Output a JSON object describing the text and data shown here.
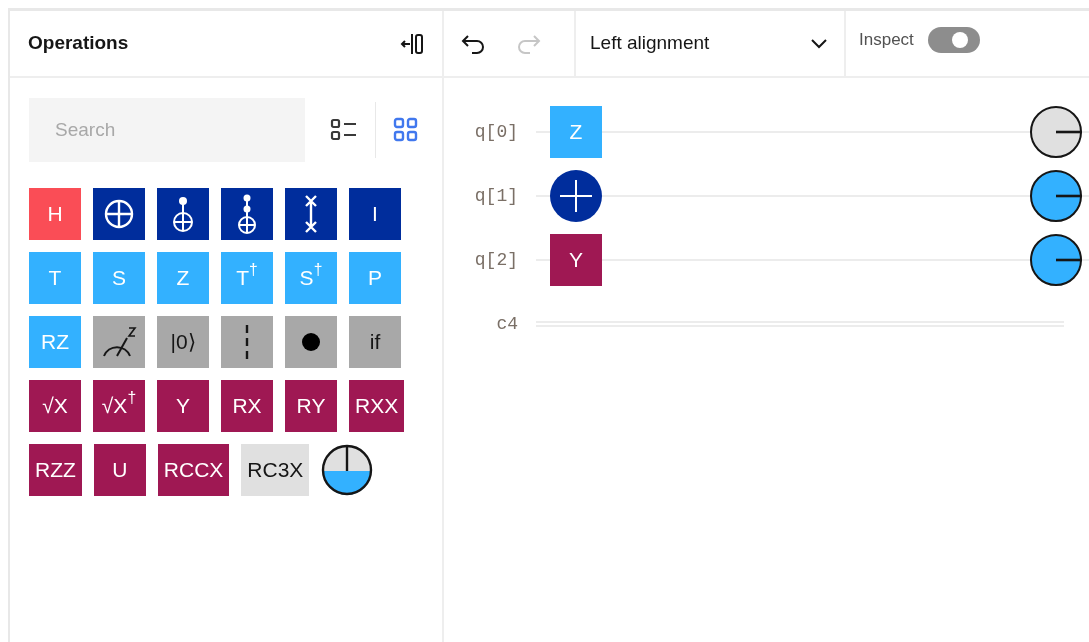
{
  "panel": {
    "title": "Operations"
  },
  "search": {
    "placeholder": "Search"
  },
  "view_buttons": [
    {
      "kind": "list",
      "selected": false
    },
    {
      "kind": "grid",
      "selected": true
    }
  ],
  "gates": [
    {
      "kind": "text",
      "label": "H",
      "color": "#fa4d56"
    },
    {
      "kind": "cnot",
      "color": "#002d9c"
    },
    {
      "kind": "toffoli",
      "color": "#002d9c"
    },
    {
      "kind": "c3x",
      "color": "#002d9c"
    },
    {
      "kind": "swap",
      "color": "#002d9c"
    },
    {
      "kind": "text",
      "label": "I",
      "color": "#002d9c"
    },
    {
      "kind": "text",
      "label": "T",
      "color": "#33b1ff"
    },
    {
      "kind": "text",
      "label": "S",
      "color": "#33b1ff"
    },
    {
      "kind": "text",
      "label": "Z",
      "color": "#33b1ff"
    },
    {
      "kind": "text",
      "label": "T$^{†}$",
      "color": "#33b1ff"
    },
    {
      "kind": "text",
      "label": "S$^{†}$",
      "color": "#33b1ff"
    },
    {
      "kind": "text",
      "label": "P",
      "color": "#33b1ff"
    },
    {
      "kind": "text",
      "label": "RZ",
      "color": "#33b1ff"
    },
    {
      "kind": "measure",
      "color": "#a8a8a8"
    },
    {
      "kind": "text",
      "label": "|0⟩",
      "color": "#a8a8a8"
    },
    {
      "kind": "barrier",
      "color": "#a8a8a8"
    },
    {
      "kind": "control",
      "color": "#a8a8a8"
    },
    {
      "kind": "text",
      "label": "if",
      "color": "#a8a8a8"
    },
    {
      "kind": "text",
      "label": "√X",
      "color": "#9f1853"
    },
    {
      "kind": "text",
      "label": "√X$^{†}$",
      "color": "#9f1853"
    },
    {
      "kind": "text",
      "label": "Y",
      "color": "#9f1853"
    },
    {
      "kind": "text",
      "label": "RX",
      "color": "#9f1853"
    },
    {
      "kind": "text",
      "label": "RY",
      "color": "#9f1853"
    },
    {
      "kind": "text",
      "label": "RXX",
      "color": "#9f1853"
    },
    {
      "kind": "text",
      "label": "RZZ",
      "color": "#9f1853"
    },
    {
      "kind": "text",
      "label": "U",
      "color": "#9f1853"
    },
    {
      "kind": "text",
      "label": "RCCX",
      "color": "#9f1853"
    },
    {
      "kind": "text",
      "label": "RC3X",
      "color": "#e0e0e0"
    },
    {
      "kind": "probability"
    }
  ],
  "toolbar": {
    "undo": {
      "disabled": false
    },
    "redo": {
      "disabled": true
    },
    "alignment": "Left alignment",
    "inspect": {
      "label": "Inspect",
      "disabled": true
    }
  },
  "circuit": {
    "qubits": [
      {
        "label": "q[0]",
        "gate": {
          "kind": "box",
          "label": "Z",
          "color": "#33b1ff"
        },
        "measure": {
          "color": "#e0e0e0"
        }
      },
      {
        "label": "q[1]",
        "gate": {
          "kind": "target",
          "color": "#002d9c"
        },
        "measure": {
          "color": "#33b1ff"
        }
      },
      {
        "label": "q[2]",
        "gate": {
          "kind": "box",
          "label": "Y",
          "color": "#9f1853"
        },
        "measure": {
          "color": "#33b1ff"
        }
      }
    ],
    "classical": {
      "label": "c4"
    }
  }
}
